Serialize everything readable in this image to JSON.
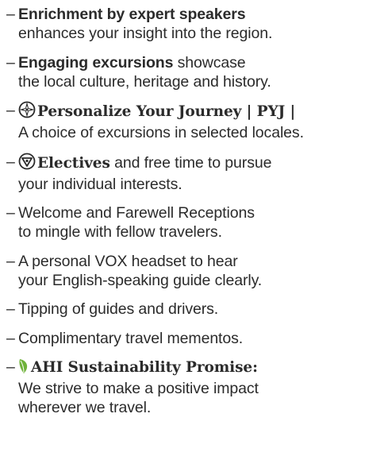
{
  "items": [
    {
      "dash": "–",
      "bold": "Enrichment by expert speakers",
      "rest": "",
      "line2": "enhances your insight into the region."
    },
    {
      "dash": "–",
      "bold": "Engaging excursions",
      "rest": " showcase",
      "line2": "the local culture, heritage and history."
    },
    {
      "dash": "–",
      "icon": "compass-rose-icon",
      "bold": "Personalize Your Journey | PYJ |",
      "rest": "",
      "line2": "A choice of excursions in selected locales."
    },
    {
      "dash": "–",
      "icon": "compass-circle-icon",
      "bold": "Electives",
      "rest": " and free time to pursue",
      "line2": "your individual interests."
    },
    {
      "dash": "–",
      "line1": "Welcome and Farewell Receptions",
      "line2": "to mingle with fellow travelers."
    },
    {
      "dash": "–",
      "line1": "A personal VOX headset to hear",
      "line2": "your English-speaking guide clearly."
    },
    {
      "dash": "–",
      "line1": "Tipping of guides and drivers."
    },
    {
      "dash": "–",
      "line1": "Complimentary travel mementos."
    },
    {
      "dash": "–",
      "icon": "leaf-icon",
      "bold": "AHI Sustainability Promise:",
      "rest": "",
      "line2": "We strive to make a positive impact",
      "line3": "wherever we travel."
    }
  ],
  "colors": {
    "text": "#2b2b2b",
    "leaf": "#6fb23a"
  }
}
